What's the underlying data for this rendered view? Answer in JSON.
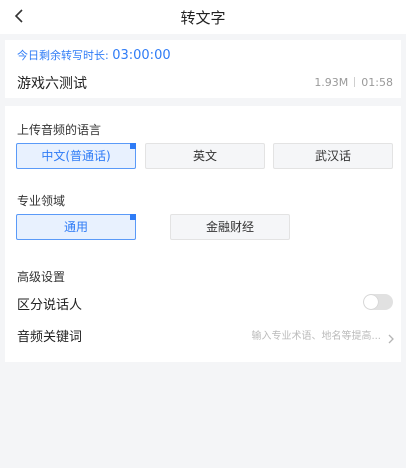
{
  "header": {
    "title": "转文字"
  },
  "remaining": {
    "label": "今日剩余转写时长:",
    "time": "03:00:00"
  },
  "file": {
    "name": "游戏六测试",
    "size": "1.93M",
    "duration": "01:58"
  },
  "language": {
    "label": "上传音频的语言",
    "options": [
      "中文(普通话)",
      "英文",
      "武汉话"
    ],
    "selected": "中文(普通话)"
  },
  "domain": {
    "label": "专业领域",
    "options": [
      "通用",
      "金融财经"
    ],
    "selected": "通用"
  },
  "advanced": {
    "label": "高级设置",
    "speaker": {
      "label": "区分说话人",
      "enabled": false
    },
    "keywords": {
      "label": "音频关键词",
      "placeholder": "输入专业术语、地名等提高..."
    }
  },
  "colors": {
    "accent": "#2f7cf6",
    "background": "#f4f5f7"
  },
  "icons": {
    "back": "chevron-left-icon",
    "arrow": "chevron-right-icon"
  }
}
